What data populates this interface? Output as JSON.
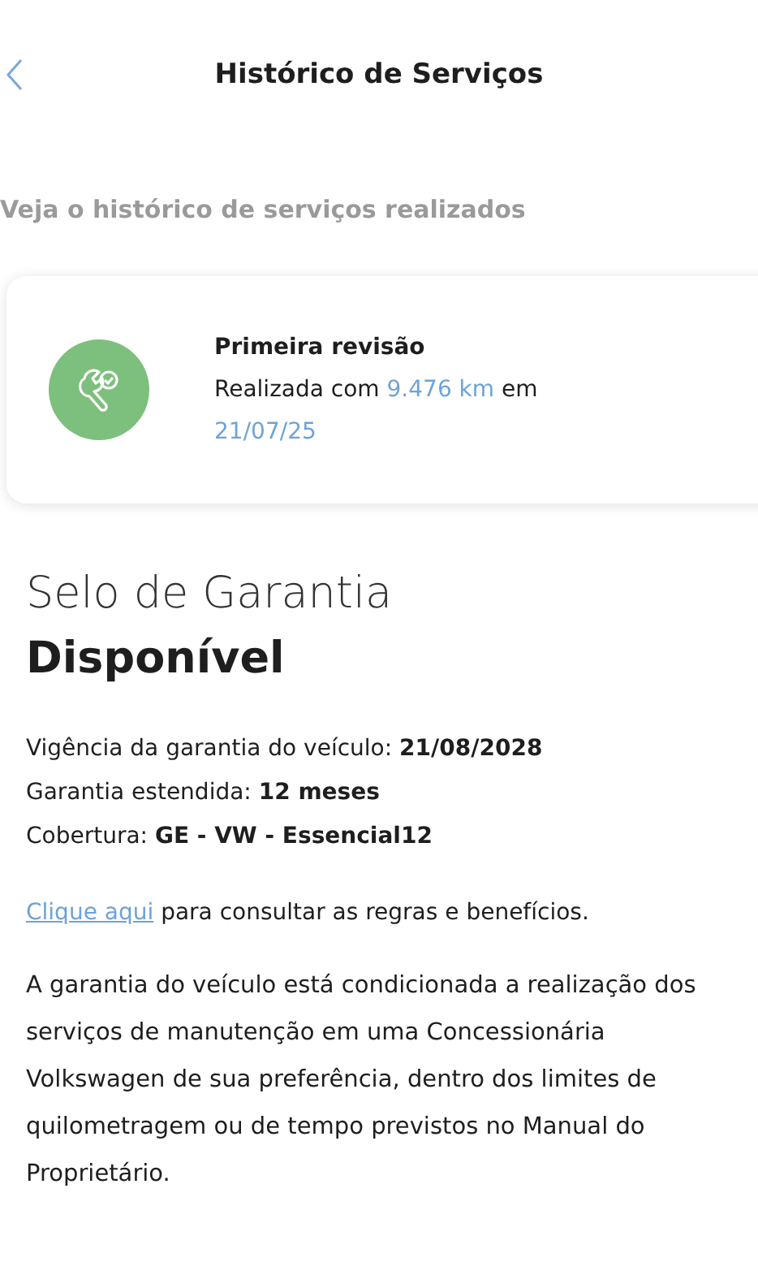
{
  "header": {
    "title": "Histórico de Serviços"
  },
  "subtitle": "Veja o histórico de serviços realizados",
  "services": [
    {
      "title": "Primeira revisão",
      "description": "Realizada com **9.476 km** em **21/07/25**"
    }
  ],
  "warranty": {
    "title": "Selo de Garantia",
    "status": "Disponível",
    "details": [
      "Vigência da garantia do veículo: **21/08/2028**",
      "Garantia estendida: **12 meses**",
      "Cobertura: **GE - VW - Essencial12**"
    ],
    "link": "Clique aqui",
    "link_rest": "para consultar as regras e benefícios.",
    "note": "A garantia do veículo está condicionada a realização dos serviços de manutenção em uma Concessionária Volkswagen de sua preferência, dentro dos limites de quilometragem ou de tempo previstos no Manual do Proprietário."
  }
}
